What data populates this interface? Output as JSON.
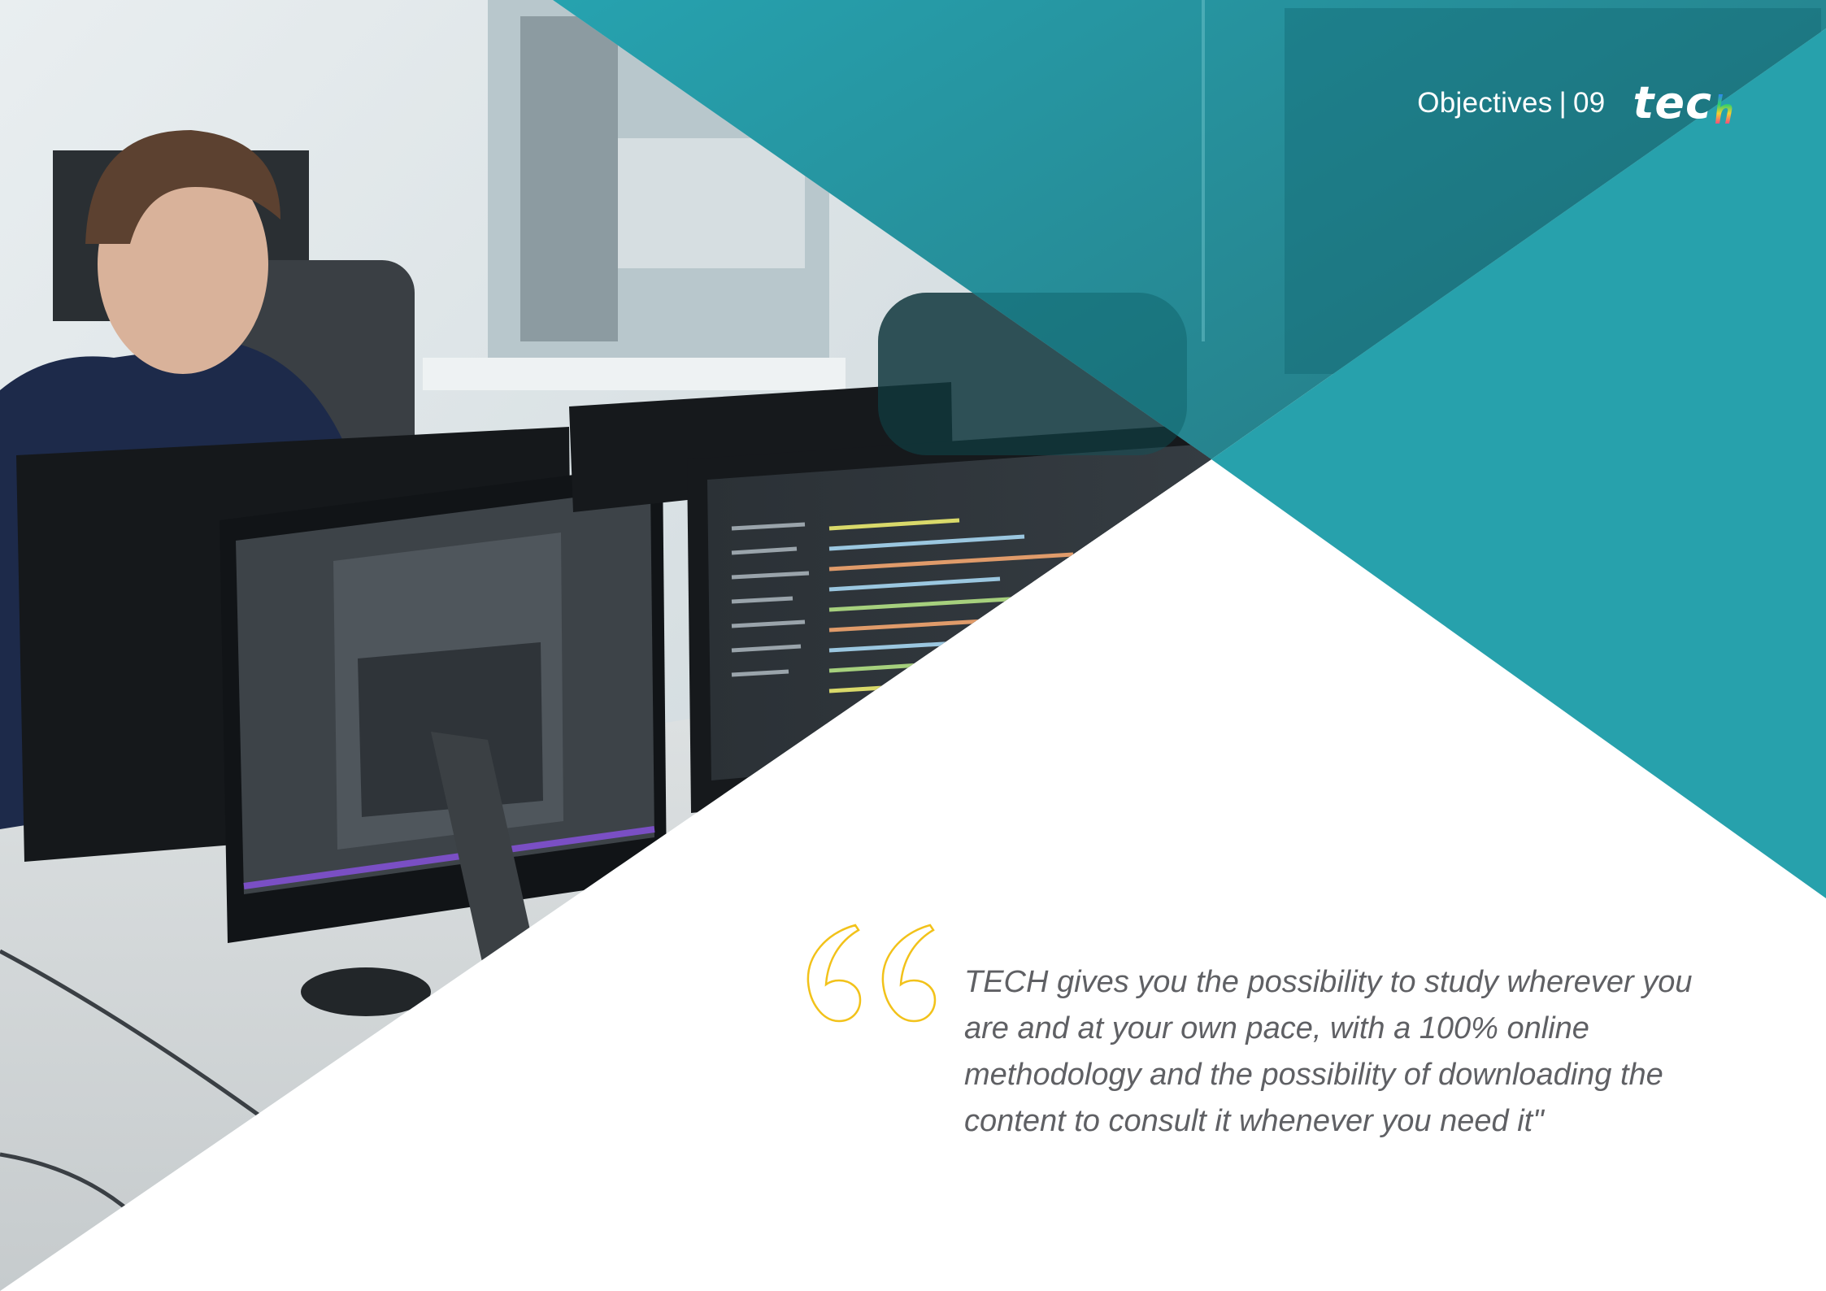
{
  "header": {
    "section": "Objectives",
    "separator": "|",
    "page_number": "09"
  },
  "logo": {
    "text": "tec",
    "icon": "tech-h-gradient-logo-icon"
  },
  "photo": {
    "icon": "office-photo-developer-at-monitors"
  },
  "quote": {
    "icon": "open-quote-icon",
    "text": "TECH gives you the possibility to study wherever you are and at your own pace, with a 100% online methodology and the possibility of downloading the content to consult it whenever you need it\""
  },
  "colors": {
    "teal": "#27a1ac",
    "teal_dark": "#1f8c98",
    "quote_yellow": "#f2c21a",
    "quote_text": "#5f6064"
  }
}
